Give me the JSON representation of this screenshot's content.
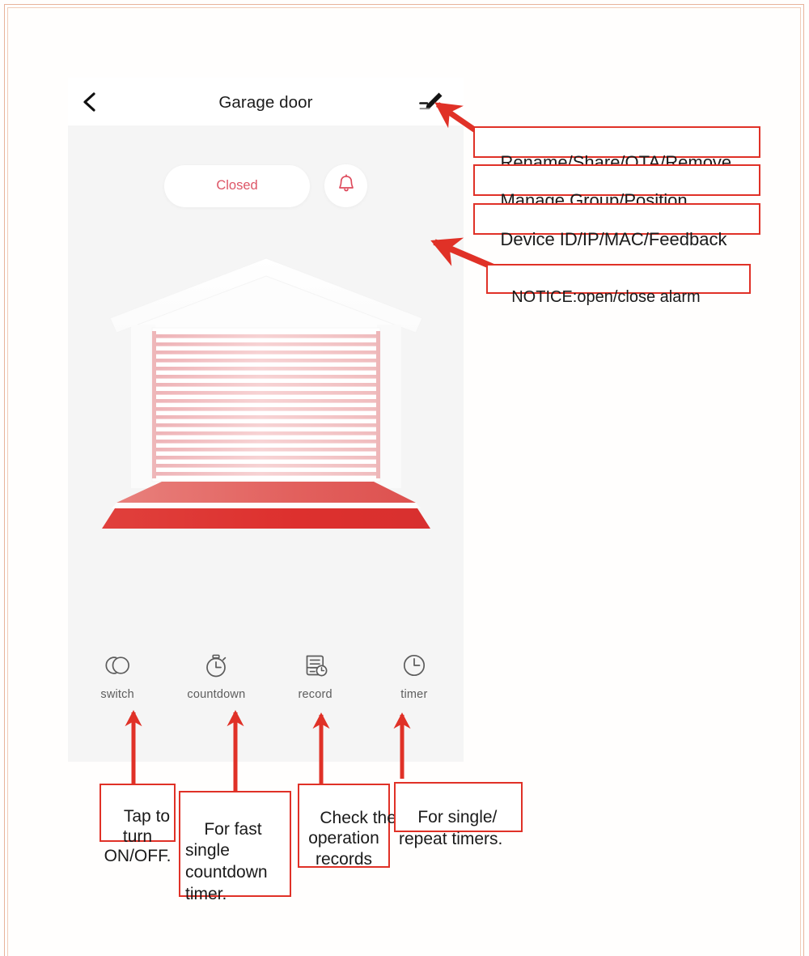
{
  "app": {
    "header": {
      "back_icon": "chevron-left-icon",
      "title": "Garage door",
      "edit_icon": "pencil-edit-icon"
    },
    "status": {
      "state_label": "Closed",
      "bell_icon": "bell-icon",
      "state_color": "#dd5566"
    },
    "illustration": {
      "name": "garage-door-illustration",
      "door_color": "#f2b4b4",
      "ramp_color": "#e2433f",
      "house_color": "#ffffff"
    },
    "tools": [
      {
        "icon": "switch-icon",
        "label": "switch"
      },
      {
        "icon": "countdown-icon",
        "label": "countdown"
      },
      {
        "icon": "record-icon",
        "label": "record"
      },
      {
        "icon": "timer-icon",
        "label": "timer"
      }
    ]
  },
  "annotations": {
    "accent_color": "#e03127",
    "top": [
      {
        "id": "rename-share-ota-remove",
        "text": "Rename/Share/OTA/Remove"
      },
      {
        "id": "manage-group-position",
        "text": "Manage Group/Position"
      },
      {
        "id": "device-id-ip-mac-feedback",
        "text": "Device ID/IP/MAC/Feedback"
      },
      {
        "id": "notice-open-close-alarm",
        "text": "NOTICE:open/close alarm"
      }
    ],
    "bottom": [
      {
        "id": "switch-note",
        "text": "Tap to\nturn\nON/OFF."
      },
      {
        "id": "countdown-note",
        "text": "For fast\nsingle\ncountdown\ntimer."
      },
      {
        "id": "record-note",
        "text": "Check the\noperation\nrecords"
      },
      {
        "id": "timer-note",
        "text": "For single/\nrepeat timers."
      }
    ]
  }
}
